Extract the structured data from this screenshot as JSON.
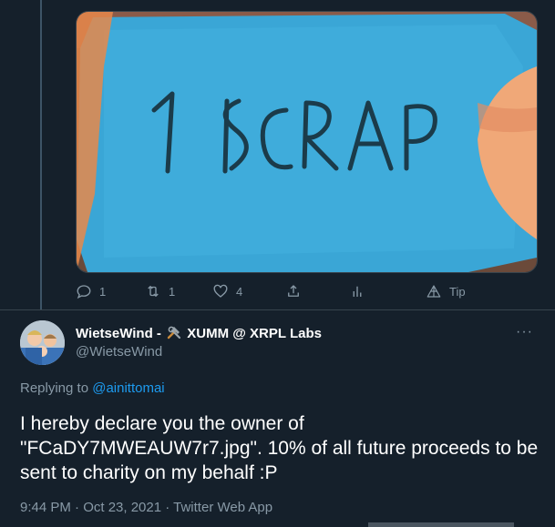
{
  "previous_tweet": {
    "actions": {
      "reply_count": "1",
      "retweet_count": "1",
      "like_count": "4",
      "tip_label": "Tip"
    }
  },
  "tweet": {
    "display_name": "WietseWind -",
    "display_name_suffix": "XUMM @ XRPL Labs",
    "handle": "@WietseWind",
    "more_icon": "···",
    "replying_prefix": "Replying to",
    "replying_to": "@ainittomai",
    "text": "I hereby declare you the owner of \"FCaDY7MWEAUW7r7.jpg\". 10% of all future proceeds to be sent to charity on my behalf :P",
    "timestamp": "9:44 PM · Oct 23, 2021 · Twitter Web App"
  },
  "colors": {
    "background": "#15202b",
    "secondary_text": "#8899a6",
    "link": "#1d9bf0",
    "border": "#38444d"
  }
}
